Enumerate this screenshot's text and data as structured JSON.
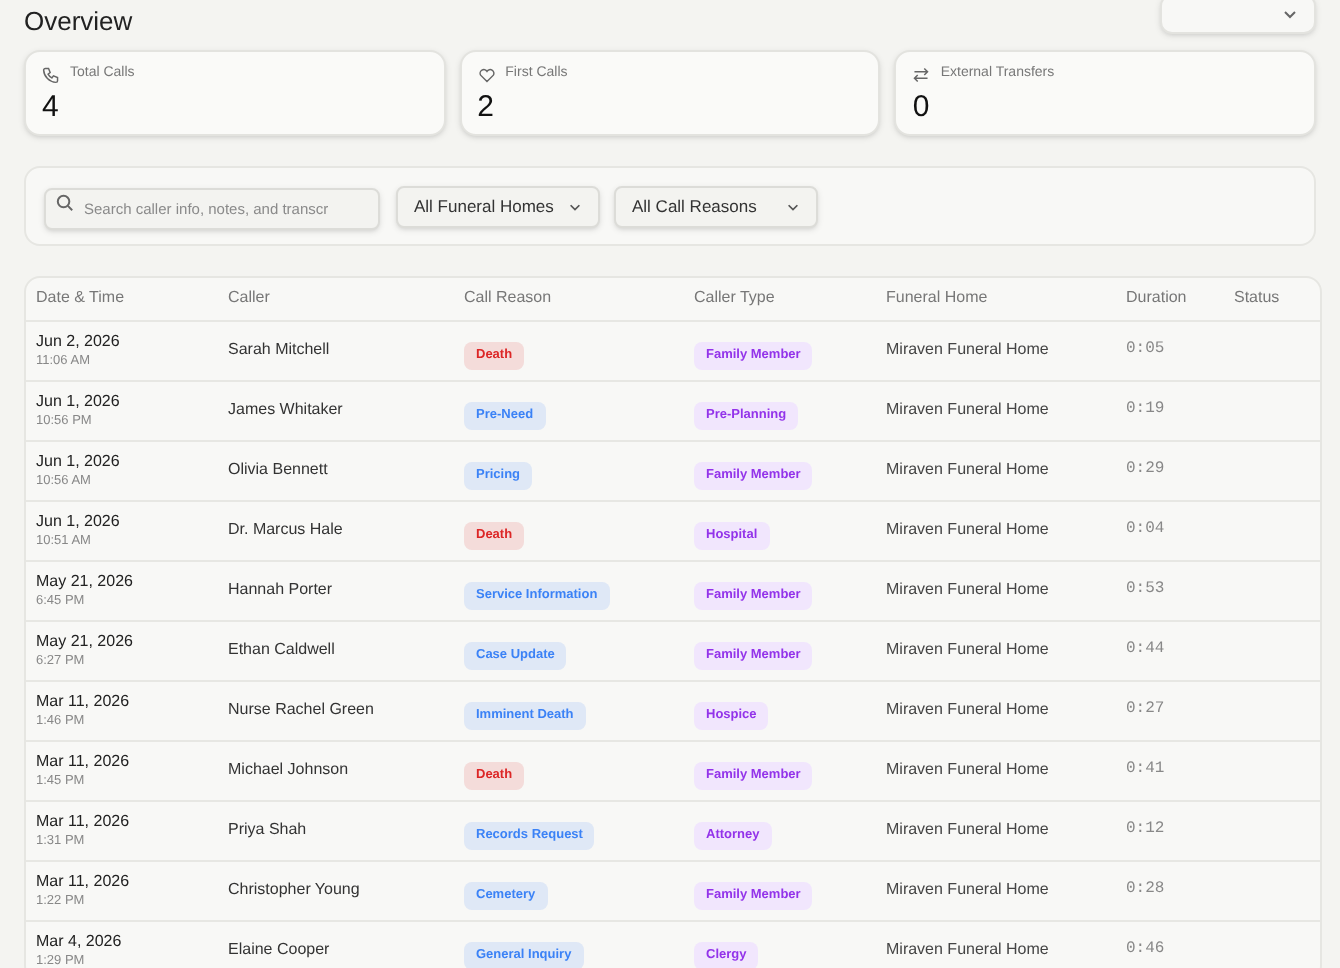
{
  "page_title": "Overview",
  "stats": [
    {
      "label": "Total Calls",
      "value": "4"
    },
    {
      "label": "First Calls",
      "value": "2"
    },
    {
      "label": "External Transfers",
      "value": "0"
    }
  ],
  "filters": {
    "search": {
      "placeholder": "Search caller info, notes, and transcr"
    },
    "dropdowns": [
      "All Funeral Homes",
      "All Call Reasons"
    ]
  },
  "table": {
    "columns": [
      "Date & Time",
      "Caller",
      "Call Reason",
      "Caller Type",
      "Funeral Home",
      "Duration",
      "Status"
    ],
    "rows": [
      {
        "date": "Jun 2, 2026",
        "time": "11:06 AM",
        "caller": "Sarah Mitchell",
        "reason": {
          "label": "Death",
          "color": "#dc2626"
        },
        "caller_type": "Family Member",
        "funeral_home": "Miraven Funeral Home",
        "duration": "0:05"
      },
      {
        "date": "Jun 1, 2026",
        "time": "10:56 PM",
        "caller": "James Whitaker",
        "reason": {
          "label": "Pre-Need",
          "color": "#3b82f6"
        },
        "caller_type": "Pre-Planning",
        "funeral_home": "Miraven Funeral Home",
        "duration": "0:19"
      },
      {
        "date": "Jun 1, 2026",
        "time": "10:56 AM",
        "caller": "Olivia Bennett",
        "reason": {
          "label": "Pricing",
          "color": "#3b82f6"
        },
        "caller_type": "Family Member",
        "funeral_home": "Miraven Funeral Home",
        "duration": "0:29"
      },
      {
        "date": "Jun 1, 2026",
        "time": "10:51 AM",
        "caller": "Dr. Marcus Hale",
        "reason": {
          "label": "Death",
          "color": "#dc2626"
        },
        "caller_type": "Hospital",
        "funeral_home": "Miraven Funeral Home",
        "duration": "0:04"
      },
      {
        "date": "May 21, 2026",
        "time": "6:45 PM",
        "caller": "Hannah Porter",
        "reason": {
          "label": "Service Information",
          "color": "#3b82f6"
        },
        "caller_type": "Family Member",
        "funeral_home": "Miraven Funeral Home",
        "duration": "0:53"
      },
      {
        "date": "May 21, 2026",
        "time": "6:27 PM",
        "caller": "Ethan Caldwell",
        "reason": {
          "label": "Case Update",
          "color": "#3b82f6"
        },
        "caller_type": "Family Member",
        "funeral_home": "Miraven Funeral Home",
        "duration": "0:44"
      },
      {
        "date": "Mar 11, 2026",
        "time": "1:46 PM",
        "caller": "Nurse Rachel Green",
        "reason": {
          "label": "Imminent Death",
          "color": "#3b82f6"
        },
        "caller_type": "Hospice",
        "funeral_home": "Miraven Funeral Home",
        "duration": "0:27"
      },
      {
        "date": "Mar 11, 2026",
        "time": "1:45 PM",
        "caller": "Michael Johnson",
        "reason": {
          "label": "Death",
          "color": "#dc2626"
        },
        "caller_type": "Family Member",
        "funeral_home": "Miraven Funeral Home",
        "duration": "0:41"
      },
      {
        "date": "Mar 11, 2026",
        "time": "1:31 PM",
        "caller": "Priya Shah",
        "reason": {
          "label": "Records Request",
          "color": "#3b82f6"
        },
        "caller_type": "Attorney",
        "funeral_home": "Miraven Funeral Home",
        "duration": "0:12"
      },
      {
        "date": "Mar 11, 2026",
        "time": "1:22 PM",
        "caller": "Christopher Young",
        "reason": {
          "label": "Cemetery",
          "color": "#3b82f6"
        },
        "caller_type": "Family Member",
        "funeral_home": "Miraven Funeral Home",
        "duration": "0:28"
      },
      {
        "date": "Mar 4, 2026",
        "time": "1:29 PM",
        "caller": "Elaine Cooper",
        "reason": {
          "label": "General Inquiry",
          "color": "#3b82f6"
        },
        "caller_type": "Clergy",
        "funeral_home": "Miraven Funeral Home",
        "duration": "0:46"
      }
    ]
  }
}
